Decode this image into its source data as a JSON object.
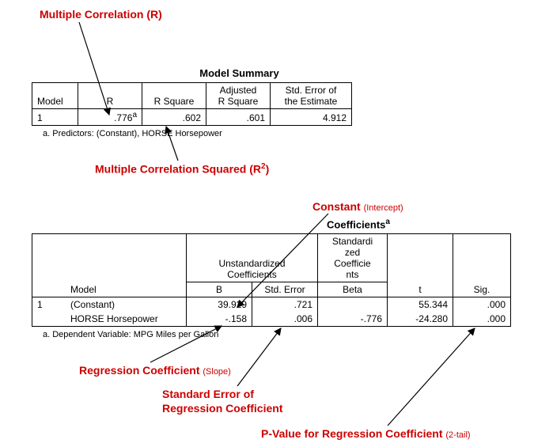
{
  "annotations": {
    "multiple_r": "Multiple Correlation (R)",
    "multiple_r2_prefix": "Multiple Correlation Squared (R",
    "multiple_r2_sup": "2",
    "multiple_r2_suffix": ")",
    "constant": "Constant",
    "constant_sub": "(Intercept)",
    "reg_coef": "Regression Coefficient",
    "reg_coef_sub": "(Slope)",
    "se_line1": "Standard Error of",
    "se_line2": "Regression Coefficient",
    "pval": "P-Value for Regression Coefficient",
    "pval_sub": "(2-tail)"
  },
  "model_summary": {
    "title": "Model Summary",
    "headers": {
      "model": "Model",
      "r": "R",
      "r_square": "R Square",
      "adj_r_square_l1": "Adjusted",
      "adj_r_square_l2": "R Square",
      "std_err_l1": "Std. Error of",
      "std_err_l2": "the Estimate"
    },
    "row": {
      "model": "1",
      "r": ".776",
      "r_sup": "a",
      "r_square": ".602",
      "adj_r_square": ".601",
      "std_err": "4.912"
    },
    "footnote": "a. Predictors: (Constant), HORSE  Horsepower"
  },
  "coefficients": {
    "title": "Coefficients",
    "title_sup": "a",
    "headers": {
      "unstd_l1": "Unstandardized",
      "unstd_l2": "Coefficients",
      "std_l1": "Standardi",
      "std_l2": "zed",
      "std_l3": "Coefficie",
      "std_l4": "nts",
      "model": "Model",
      "b": "B",
      "se": "Std. Error",
      "beta": "Beta",
      "t": "t",
      "sig": "Sig."
    },
    "rows": [
      {
        "model": "1",
        "name": "(Constant)",
        "b": "39.929",
        "se": ".721",
        "beta": "",
        "t": "55.344",
        "sig": ".000"
      },
      {
        "model": "",
        "name": "HORSE  Horsepower",
        "b": "-.158",
        "se": ".006",
        "beta": "-.776",
        "t": "-24.280",
        "sig": ".000"
      }
    ],
    "footnote": "a. Dependent Variable: MPG  Miles per Gallon"
  }
}
